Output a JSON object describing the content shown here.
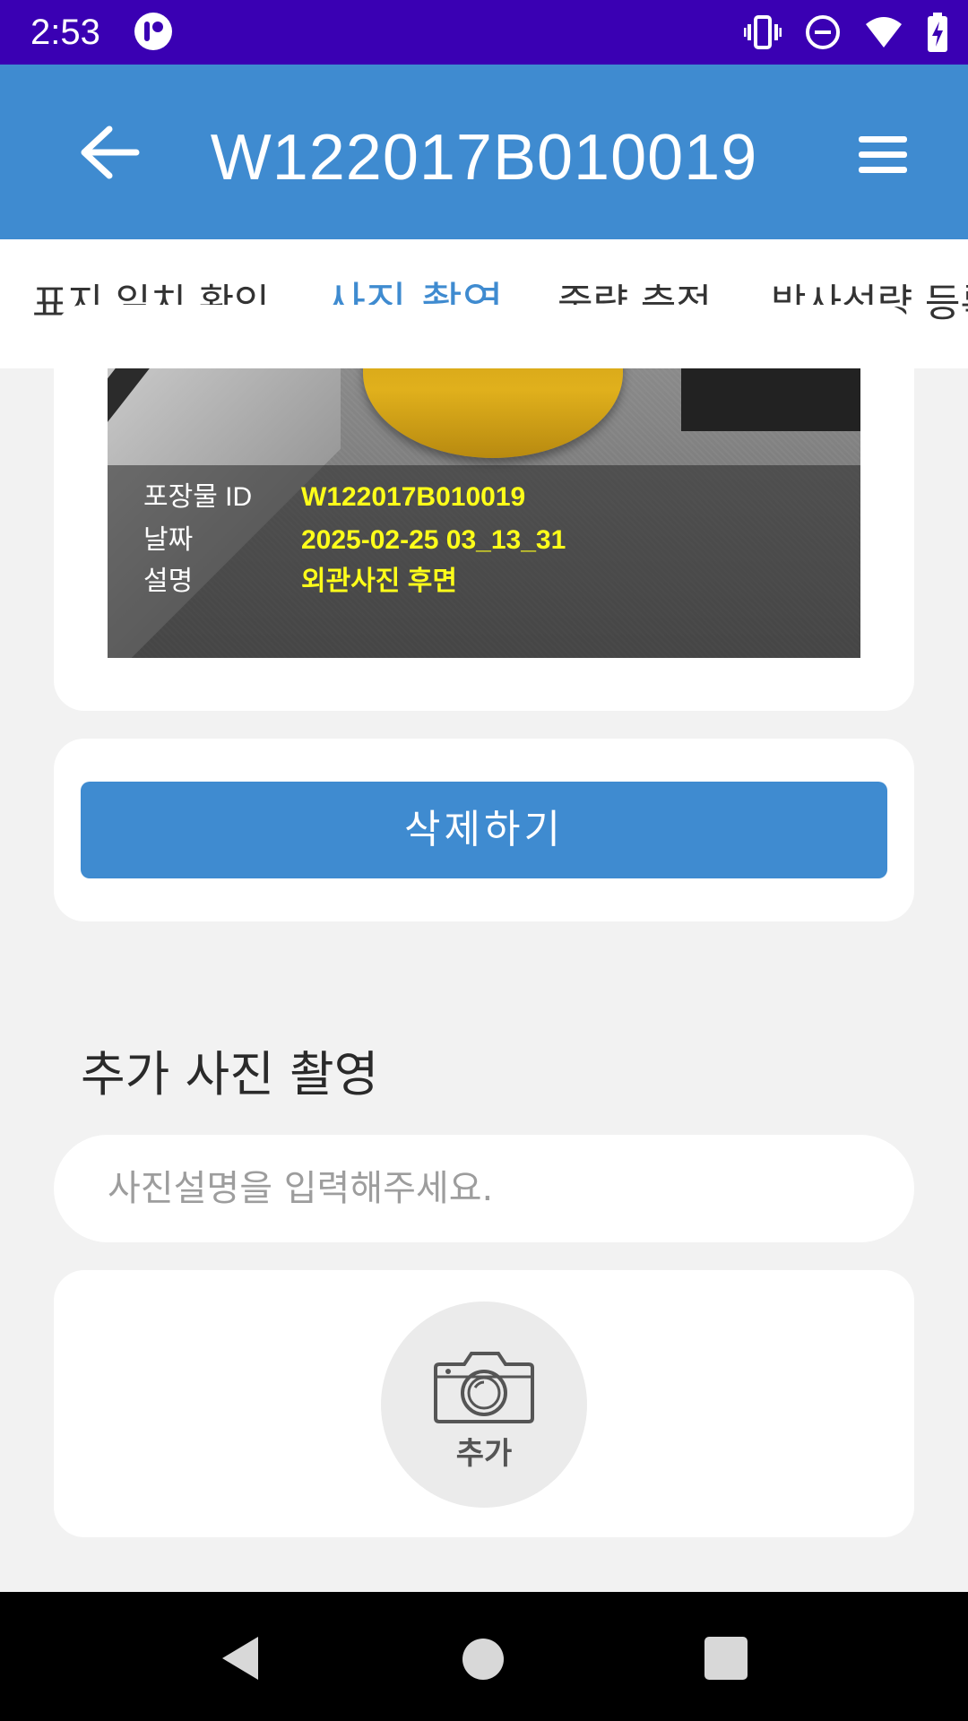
{
  "status_bar": {
    "time": "2:53",
    "app_icon": "app-notification-icon",
    "icons": [
      "vibrate-icon",
      "do-not-disturb-icon",
      "wifi-icon",
      "battery-charging-icon"
    ],
    "wifi_badge": "4"
  },
  "app_bar": {
    "title": "W122017B010019",
    "back_icon": "arrow-left-icon",
    "menu_icon": "hamburger-menu-icon"
  },
  "tabs": [
    {
      "label": "표지 일치 확인",
      "active": false
    },
    {
      "label": "사진 촬영",
      "active": true
    },
    {
      "label": "중량 측정",
      "active": false
    },
    {
      "label": "방사선량 등록",
      "active": false
    }
  ],
  "photo": {
    "rows": [
      {
        "key": "포장물 ID",
        "value": "W122017B010019"
      },
      {
        "key": "날짜",
        "value": "2025-02-25 03_13_31"
      },
      {
        "key": "설명",
        "value": "외관사진 후면"
      }
    ]
  },
  "delete_button": {
    "label": "삭제하기"
  },
  "additional": {
    "title": "추가 사진 촬영",
    "description_placeholder": "사진설명을 입력해주세요.",
    "description_value": "",
    "add_label": "추가",
    "add_icon": "camera-icon"
  },
  "nav_bar": {
    "icons": [
      "nav-back-icon",
      "nav-home-icon",
      "nav-recents-icon"
    ]
  },
  "colors": {
    "status_bar": "#3a00b3",
    "primary": "#3f8bd0",
    "background": "#f2f2f2",
    "overlay_value": "#ffff1a"
  }
}
